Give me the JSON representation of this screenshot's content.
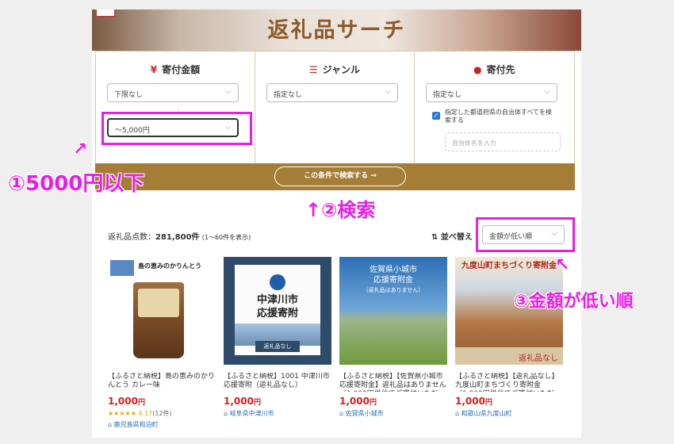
{
  "hero": {
    "title": "返礼品サーチ"
  },
  "filters": {
    "amount": {
      "label": "寄付金額",
      "min_value": "下限なし",
      "max_value": "〜5,000円"
    },
    "genre": {
      "label": "ジャンル",
      "value": "指定なし"
    },
    "region": {
      "label": "寄付先",
      "value": "指定なし",
      "checkbox_label": "指定した都道府県の自治体すべてを検索する",
      "municipality_placeholder": "自治体名を入力"
    }
  },
  "search_button": "この条件で検索する →",
  "results": {
    "count_prefix": "返礼品点数：",
    "count_value": "281,800件",
    "count_range": "(1〜60件を表示)",
    "sort_label": "並べ替え",
    "sort_value": "金額が低い順"
  },
  "products": [
    {
      "brand_text": "島の恵みのかりんとう",
      "title": "【ふるさと納税】島の恵みのかりんとう カレー味",
      "price": "1,000",
      "price_unit": "円",
      "rating": "4.17",
      "reviews": "(12件)",
      "location": "鹿児島県和泊町"
    },
    {
      "city_line1": "中津川市",
      "city_line2": "応援寄附",
      "tag": "返礼品なし",
      "title": "【ふるさと納税】1001 中津川市応援寄附（返礼品なし）",
      "price": "1,000",
      "price_unit": "円",
      "location": "岐阜県中津川市"
    },
    {
      "img_line1": "佐賀県小城市",
      "img_line2": "応援寄附金",
      "img_line3": "（返礼品はありません）",
      "title": "【ふるさと納税】【佐賀県小城市応援寄附金】返礼品はありません（1,000円単位でご寄付いただけ…",
      "price": "1,000",
      "price_unit": "円",
      "location": "佐賀県小城市"
    },
    {
      "img_top": "九度山町まちづくり寄附金",
      "tag": "返礼品なし",
      "title": "【ふるさと納税】【返礼品なし】九度山町まちづくり寄附金（1,000円単位でご寄付いただ…",
      "price": "1,000",
      "price_unit": "円",
      "location": "和歌山県九度山町"
    }
  ],
  "annotations": {
    "step1": "①5000円以下",
    "step2": "↑②検索",
    "step3": "③金額が低い順"
  },
  "colors": {
    "accent": "#e81fe0",
    "gold": "#a47d36",
    "price": "#d21f1f"
  }
}
